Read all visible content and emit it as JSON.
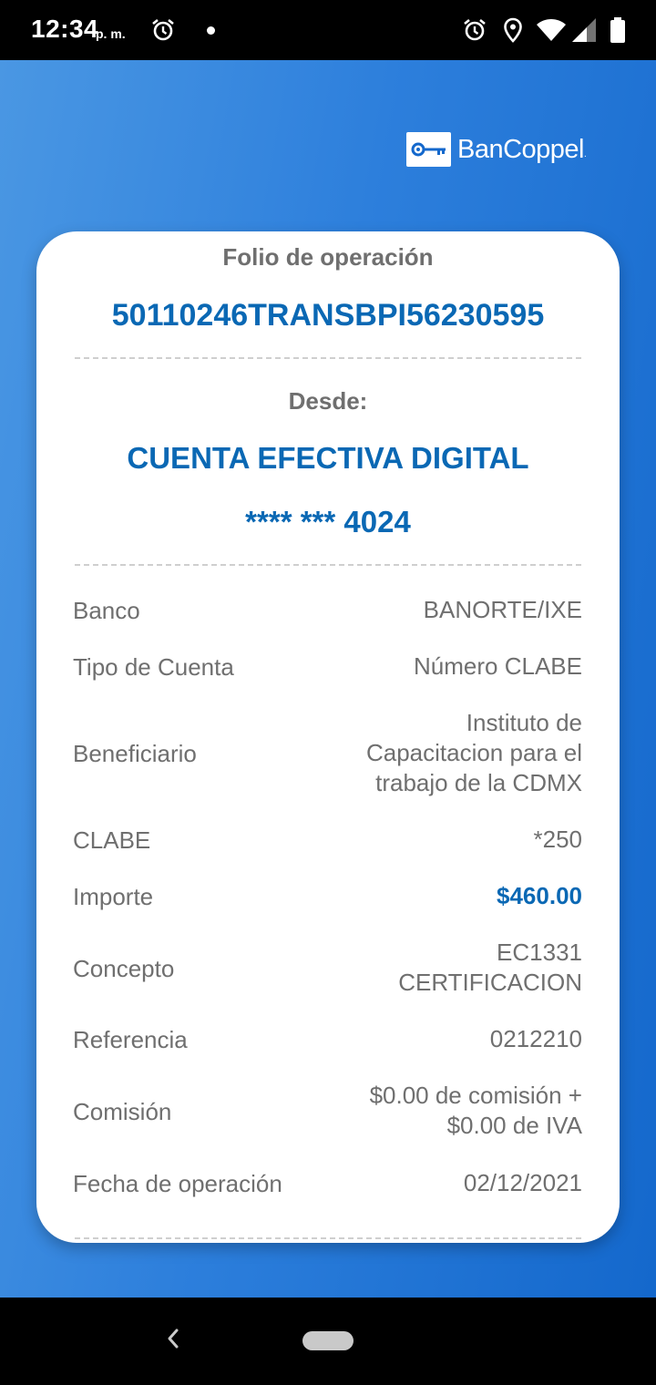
{
  "status_bar": {
    "time": "12:34",
    "ampm": "p. m.",
    "icons": [
      "alarm-icon",
      "notification-dot",
      "alarm-icon",
      "location-icon",
      "wifi-icon",
      "signal-icon",
      "battery-icon"
    ]
  },
  "brand": {
    "name": "BanCoppel",
    "trademark": "."
  },
  "receipt": {
    "folio_label": "Folio de operación",
    "folio_value": "50110246TRANSBPI56230595",
    "from_label": "Desde:",
    "account_name": "CUENTA EFECTIVA DIGITAL",
    "account_number": "**** *** 4024",
    "rows": [
      {
        "label": "Banco",
        "value": "BANORTE/IXE"
      },
      {
        "label": "Tipo de Cuenta",
        "value": "Número CLABE"
      },
      {
        "label": "Beneficiario",
        "value_lines": [
          "Instituto de",
          "Capacitacion para el",
          "trabajo de la CDMX"
        ]
      },
      {
        "label": "CLABE",
        "value": "*250"
      },
      {
        "label": "Importe",
        "value": "$460.00"
      },
      {
        "label": "Concepto",
        "value_lines": [
          "EC1331",
          "CERTIFICACION"
        ]
      },
      {
        "label": "Referencia",
        "value": "0212210"
      },
      {
        "label": "Comisión",
        "value_lines": [
          "$0.00 de comisión +",
          "$0.00 de IVA"
        ]
      },
      {
        "label": "Fecha de operación",
        "value": "02/12/2021"
      }
    ]
  },
  "colors": {
    "accent": "#0a68b4",
    "text_gray": "#6f6f6f",
    "bg_from": "#4a97e3",
    "bg_to": "#1468cc"
  }
}
